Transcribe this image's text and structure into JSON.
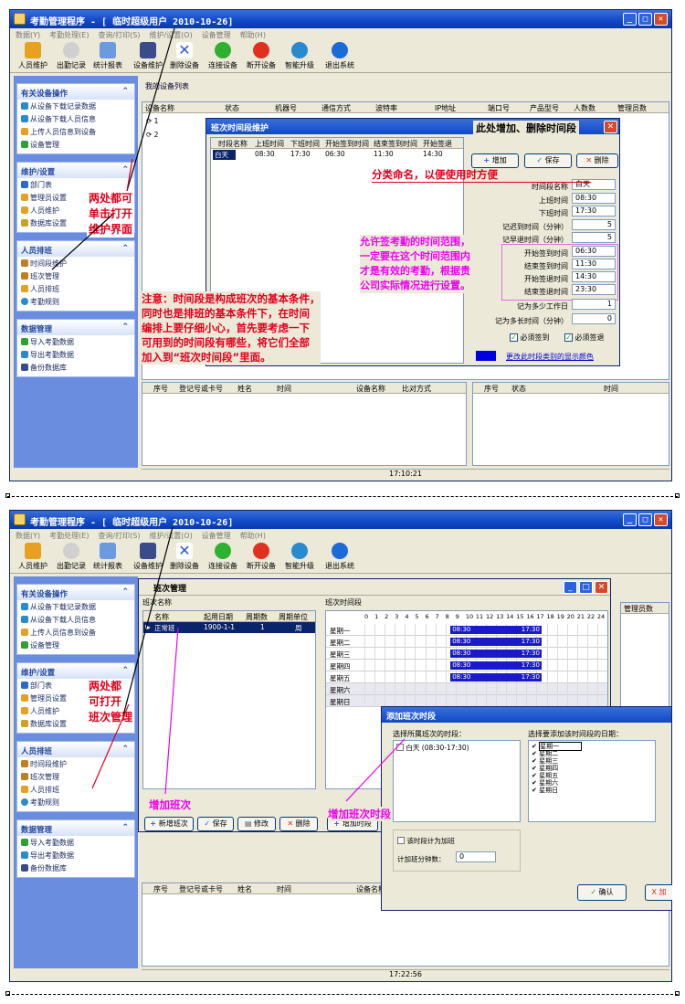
{
  "app_title": "考勤管理程序 - [ 临时超级用户 2010-10-26]",
  "menu": [
    "数据(Y)",
    "考勤处理(E)",
    "查询/打印(S)",
    "维护/设置(O)",
    "设备管理",
    "帮助(H)"
  ],
  "toolbar": [
    "人员维护",
    "出勤记录",
    "统计报表",
    "设备维护",
    "删除设备",
    "连接设备",
    "断开设备",
    "智能升级",
    "退出系统"
  ],
  "sidebar": {
    "device_ops": {
      "title": "有关设备操作",
      "items": [
        "从设备下载记录数据",
        "从设备下载人员信息",
        "上传人员信息到设备",
        "设备管理"
      ]
    },
    "maintain": {
      "title": "维护/设置",
      "items": [
        "部门表",
        "管理员设置",
        "人员维护",
        "数据库设置"
      ]
    },
    "schedule": {
      "title": "人员排班",
      "items": [
        "时间段维护",
        "班次管理",
        "人员排班",
        "考勤规则"
      ]
    },
    "data": {
      "title": "数据管理",
      "items": [
        "导入考勤数据",
        "导出考勤数据",
        "备份数据库"
      ]
    }
  },
  "panel1": {
    "device_list_title": "我的设备列表",
    "device_cols": [
      "设备名称",
      "状态",
      "机器号",
      "通信方式",
      "波特率",
      "IP地址",
      "端口号",
      "产品型号",
      "人数数",
      "管理员数"
    ],
    "device_rows": [
      "1",
      "2"
    ],
    "log_cols": [
      "序号",
      "登记号或卡号",
      "姓名",
      "时间",
      "设备名称",
      "比对方式"
    ],
    "right_cols": [
      "序号",
      "状态",
      "时间"
    ],
    "status_time": "17:10:21"
  },
  "dialog_timeslot": {
    "title": "班次时间段维护",
    "red_title": "此处增加、删除时间段",
    "cols": [
      "时段名称",
      "上班时间",
      "下班时间",
      "开始签到时间",
      "结束签到时间",
      "开始签退"
    ],
    "row": [
      "白天",
      "08:30",
      "17:30",
      "06:30",
      "11:30",
      "14:30"
    ],
    "buttons": [
      "增加",
      "保存",
      "删除"
    ],
    "fields": [
      {
        "label": "时间段名称",
        "value": "白天"
      },
      {
        "label": "上班时间",
        "value": "08:30"
      },
      {
        "label": "下班时间",
        "value": "17:30"
      },
      {
        "label": "记迟到时间（分钟）",
        "value": "5"
      },
      {
        "label": "记早退时间（分钟）",
        "value": "5"
      },
      {
        "label": "开始签到时间",
        "value": "06:30"
      },
      {
        "label": "结束签到时间",
        "value": "11:30"
      },
      {
        "label": "开始签退时间",
        "value": "14:30"
      },
      {
        "label": "结束签退时间",
        "value": "23:30"
      },
      {
        "label": "记为多少工作日",
        "value": "1"
      },
      {
        "label": "记为多长时间（分钟）",
        "value": "0"
      }
    ],
    "check_in": "必须签到",
    "check_out": "必须签退",
    "color_link": "更改此时段类别的显示颜色"
  },
  "annotations1": {
    "two_places": "两处都可\n单击打开\n维护界面",
    "naming": "分类命名，以便使用时方便",
    "range": "允许签考勤的时间范围，\n一定要在这个时间范围内\n才是有效的考勤，根据贵\n公司实际情况进行设置。",
    "note": "注意：时间段是构成班次的基本条件，\n同时也是排班的基本条件下，在时间\n编排上要仔细小心，首先要考虑一下\n可用到的时间段有哪些，将它们全部\n加入到“班次时间段”里面。"
  },
  "panel2": {
    "dialog_title": "班次管理",
    "shift_cols": [
      "班次名称",
      "名称",
      "起用日期",
      "周期数",
      "周期单位"
    ],
    "shift_row": [
      "正常班",
      "1900-1-1",
      "1",
      "周"
    ],
    "schedule_title": "班次时间段",
    "hours": [
      "0",
      "1",
      "2",
      "3",
      "4",
      "5",
      "6",
      "7",
      "8",
      "9",
      "10",
      "11",
      "12",
      "13",
      "14",
      "15",
      "16",
      "17",
      "18",
      "19",
      "20",
      "21",
      "22",
      "24"
    ],
    "days": [
      "星期一",
      "星期二",
      "星期三",
      "星期四",
      "星期五",
      "星期六",
      "星期日"
    ],
    "bar_start": "08:30",
    "bar_end": "17:30",
    "buttons": [
      "新增班次",
      "保存",
      "修改",
      "删除",
      "增加时段"
    ],
    "right_col": "管理员数",
    "log_cols": [
      "序号",
      "登记号或卡号",
      "姓名",
      "时间",
      "设备名称"
    ],
    "status_time": "17:22:56"
  },
  "dialog_add": {
    "title": "添加班次时段",
    "left_label": "选择所属班次的时段：",
    "slot": "白天 (08:30-17:30)",
    "right_label": "选择要添加该时间段的日期：",
    "days": [
      "星期一",
      "星期二",
      "星期三",
      "星期四",
      "星期五",
      "星期六",
      "星期日"
    ],
    "overtime": "该时段计为加班",
    "overtime_minutes_label": "计加班分钟数：",
    "overtime_minutes": "0",
    "ok": "确认",
    "cancel": "X 加"
  },
  "annotations2": {
    "two_places": "两处都\n可打开\n班次管理",
    "add_shift": "增加班次",
    "add_slot": "增加班次时段"
  }
}
